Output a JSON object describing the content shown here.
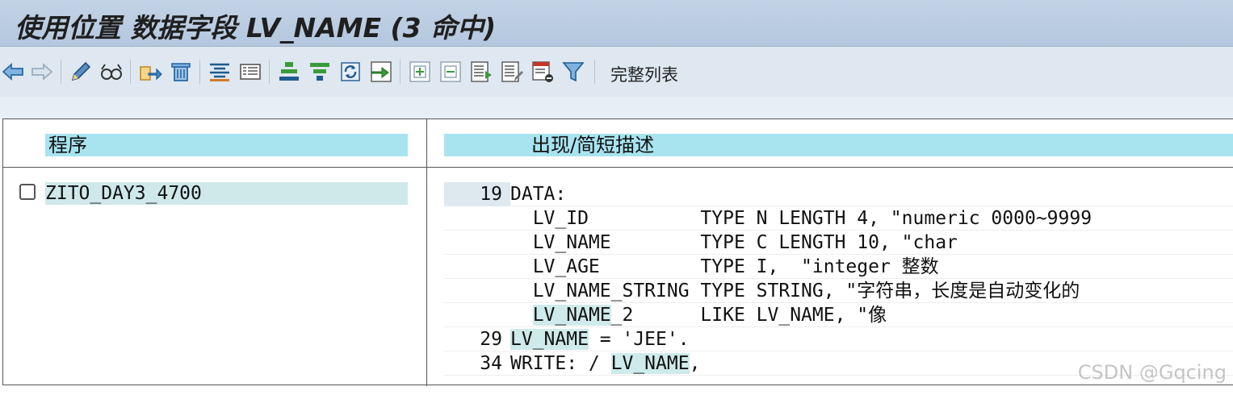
{
  "title": "使用位置 数据字段 LV_NAME (3 命中)",
  "toolbar": {
    "icons": [
      "back-arrow-icon",
      "forward-arrow-icon",
      "pencil-icon",
      "glasses-icon",
      "export-icon",
      "trash-icon",
      "align-center-icon",
      "detail-icon",
      "expand-icon",
      "collapse-icon",
      "refresh-icon",
      "navigate-icon",
      "add-icon",
      "remove-icon",
      "list-icon",
      "edit-list-icon",
      "delete-list-icon",
      "filter-icon"
    ],
    "full_list_label": "完整列表"
  },
  "table": {
    "col1_header": "程序",
    "col2_header": "出现/简短描述",
    "program": "ZITO_DAY3_4700",
    "code_lines": [
      {
        "line_no": "19",
        "text": "DATA:"
      },
      {
        "line_no": "",
        "text": "  LV_ID          TYPE N LENGTH 4, \"numeric 0000~9999"
      },
      {
        "line_no": "",
        "text": "  LV_NAME        TYPE C LENGTH 10, \"char"
      },
      {
        "line_no": "",
        "text": "  LV_AGE         TYPE I,  \"integer 整数"
      },
      {
        "line_no": "",
        "text": "  LV_NAME_STRING TYPE STRING, \"字符串，长度是自动变化的"
      },
      {
        "line_no": "",
        "text": "  LV_NAME_2      LIKE LV_NAME, \"像"
      },
      {
        "line_no": "29",
        "text": "LV_NAME = 'JEE'."
      },
      {
        "line_no": "34",
        "text": "WRITE: / LV_NAME,"
      }
    ]
  },
  "watermark": "CSDN @Gqcing",
  "colors": {
    "title_bar": "#c3d3e6",
    "toolbar": "#dfe8f1",
    "header_cell": "#a8e3f0",
    "highlight": "#cfeaea"
  }
}
